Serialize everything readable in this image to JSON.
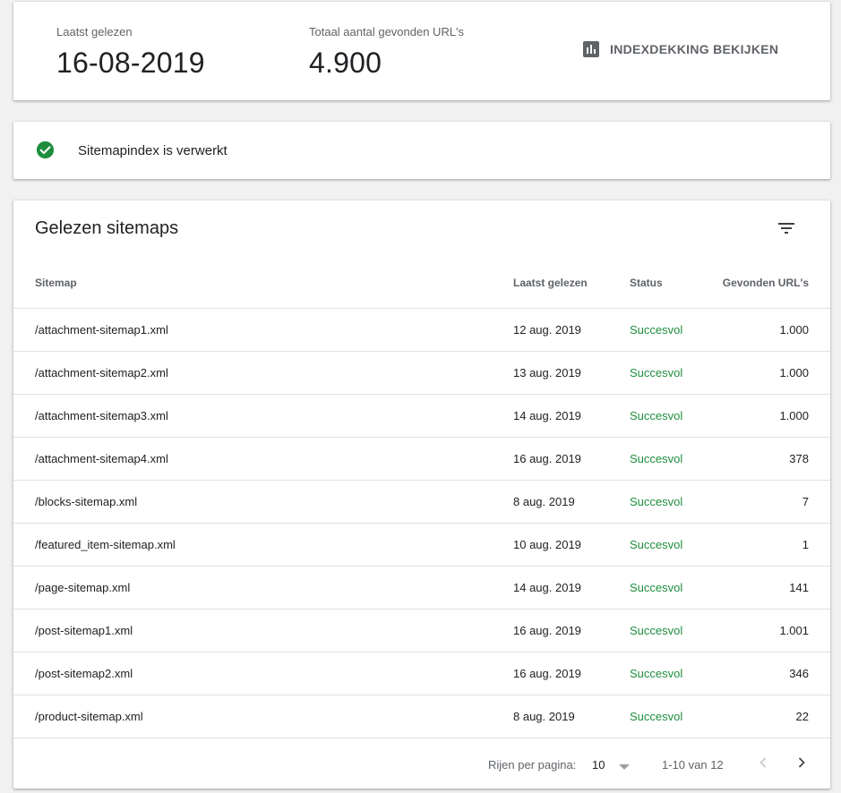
{
  "summary": {
    "last_read_label": "Laatst gelezen",
    "last_read_value": "16-08-2019",
    "total_label": "Totaal aantal gevonden URL's",
    "total_value": "4.900",
    "coverage_button": "INDEXDEKKING BEKIJKEN",
    "coverage_icon": "bar-chart-icon"
  },
  "status": {
    "icon": "check-circle-icon",
    "text": "Sitemapindex is verwerkt",
    "color": "#1e8e3e"
  },
  "table": {
    "title": "Gelezen sitemaps",
    "filter_icon": "filter-icon",
    "columns": [
      "Sitemap",
      "Laatst gelezen",
      "Status",
      "Gevonden URL's"
    ],
    "rows": [
      {
        "sitemap": "/attachment-sitemap1.xml",
        "last_read": "12 aug. 2019",
        "status": "Succesvol",
        "urls": "1.000"
      },
      {
        "sitemap": "/attachment-sitemap2.xml",
        "last_read": "13 aug. 2019",
        "status": "Succesvol",
        "urls": "1.000"
      },
      {
        "sitemap": "/attachment-sitemap3.xml",
        "last_read": "14 aug. 2019",
        "status": "Succesvol",
        "urls": "1.000"
      },
      {
        "sitemap": "/attachment-sitemap4.xml",
        "last_read": "16 aug. 2019",
        "status": "Succesvol",
        "urls": "378"
      },
      {
        "sitemap": "/blocks-sitemap.xml",
        "last_read": "8 aug. 2019",
        "status": "Succesvol",
        "urls": "7"
      },
      {
        "sitemap": "/featured_item-sitemap.xml",
        "last_read": "10 aug. 2019",
        "status": "Succesvol",
        "urls": "1"
      },
      {
        "sitemap": "/page-sitemap.xml",
        "last_read": "14 aug. 2019",
        "status": "Succesvol",
        "urls": "141"
      },
      {
        "sitemap": "/post-sitemap1.xml",
        "last_read": "16 aug. 2019",
        "status": "Succesvol",
        "urls": "1.001"
      },
      {
        "sitemap": "/post-sitemap2.xml",
        "last_read": "16 aug. 2019",
        "status": "Succesvol",
        "urls": "346"
      },
      {
        "sitemap": "/product-sitemap.xml",
        "last_read": "8 aug. 2019",
        "status": "Succesvol",
        "urls": "22"
      }
    ],
    "status_color": "#1e8e3e"
  },
  "pagination": {
    "rows_per_page_label": "Rijen per pagina:",
    "rows_per_page_value": "10",
    "range": "1-10 van 12",
    "prev_icon": "chevron-left-icon",
    "next_icon": "chevron-right-icon"
  }
}
